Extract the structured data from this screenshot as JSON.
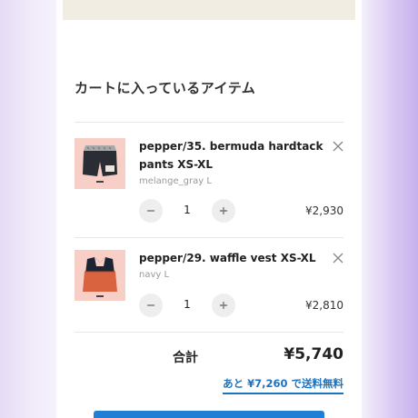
{
  "cart": {
    "title": "カートに入っているアイテム",
    "items": [
      {
        "name": "pepper/35. bermuda hardtack pants XS-XL",
        "variant": "melange_gray L",
        "quantity": "1",
        "price": "¥2,930",
        "image_icon": "shorts-photo",
        "remove_icon": "close-icon"
      },
      {
        "name": "pepper/29. waffle vest XS-XL",
        "variant": "navy L",
        "quantity": "1",
        "price": "¥2,810",
        "image_icon": "vest-photo",
        "remove_icon": "close-icon"
      }
    ],
    "decrease_icon": "minus-icon",
    "increase_icon": "plus-icon"
  },
  "summary": {
    "total_label": "合計",
    "total_value": "¥5,740",
    "free_shipping_text": "あと ¥7,260 で送料無料"
  },
  "colors": {
    "accent": "#1e73be",
    "button": "#1f7fd4",
    "thumb_bg": "#f7cfc6",
    "banner": "#f1ede2"
  }
}
